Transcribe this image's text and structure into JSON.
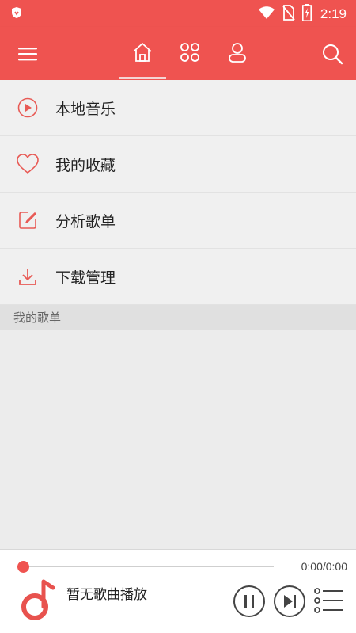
{
  "status_bar": {
    "time": "2:19",
    "icons": [
      "shield-icon",
      "wifi-icon",
      "no-sim-icon",
      "battery-charging-icon"
    ]
  },
  "appbar": {
    "icons": [
      "menu-icon",
      "home-icon",
      "discover-icon",
      "user-icon",
      "search-icon"
    ],
    "active_tab": "home",
    "background": "#ef5350"
  },
  "menu": {
    "items": [
      {
        "label": "本地音乐",
        "icon": "play-circle-icon"
      },
      {
        "label": "我的收藏",
        "icon": "heart-icon"
      },
      {
        "label": "分析歌单",
        "icon": "edit-icon"
      },
      {
        "label": "下载管理",
        "icon": "download-icon"
      }
    ]
  },
  "section": {
    "title": "我的歌单"
  },
  "player": {
    "song_title": "暂无歌曲播放",
    "time": "0:00/0:00",
    "progress": 0
  },
  "colors": {
    "accent": "#ef5350",
    "background": "#ececec"
  }
}
